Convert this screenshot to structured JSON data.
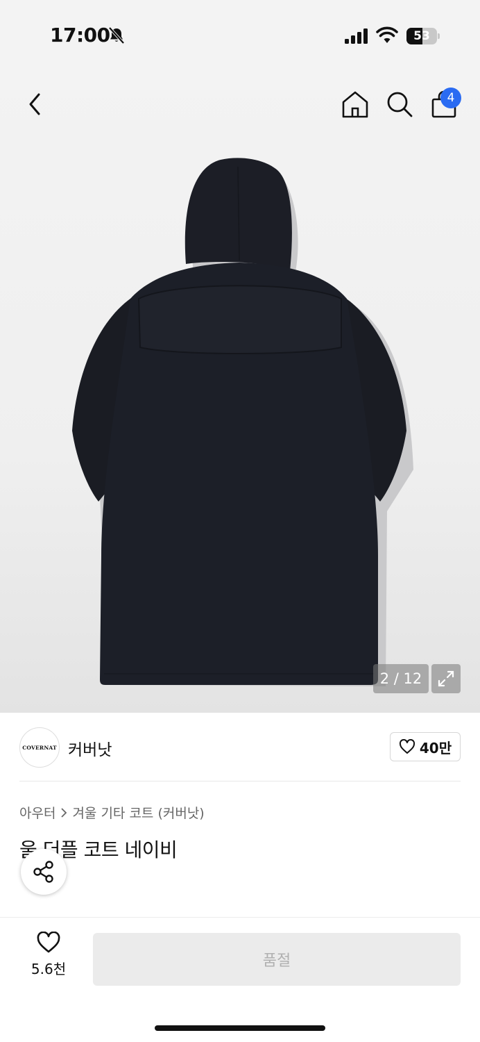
{
  "status_bar": {
    "time": "17:00",
    "battery_percent": "53",
    "battery_level": 0.53,
    "icons": [
      "bell-off-icon",
      "signal-icon",
      "wifi-icon",
      "battery-icon"
    ]
  },
  "top_nav": {
    "icons": [
      "back-arrow-icon",
      "home-icon",
      "search-icon",
      "shopping-bag-icon"
    ],
    "cart_count": "4",
    "badge_color": "#2a6bf2"
  },
  "gallery": {
    "counter": "2 / 12",
    "icons": [
      "expand-icon"
    ]
  },
  "brand": {
    "logo_text": "COVERNAT",
    "name": "커버낫",
    "like_count": "40만"
  },
  "product": {
    "breadcrumb": [
      "아우터",
      "겨울 기타 코트 (커버낫)"
    ],
    "title": "울 더플 코트 네이비"
  },
  "bottom_bar": {
    "wish_count": "5.6천",
    "buy_label": "품절"
  }
}
